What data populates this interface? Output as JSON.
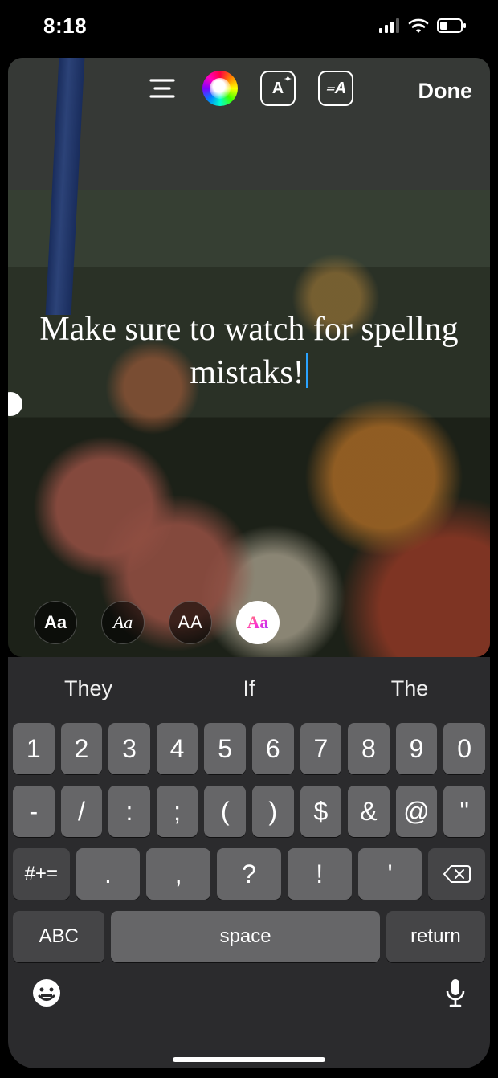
{
  "status": {
    "time": "8:18"
  },
  "toolbar": {
    "text_style_label": "A",
    "animate_label": "A",
    "done_label": "Done"
  },
  "story": {
    "text": "Make sure to watch for spellng mistaks!"
  },
  "font_picker": {
    "options": [
      "Aa",
      "Aa",
      "AA",
      "Aa"
    ],
    "selected_index": 3
  },
  "keyboard": {
    "suggestions": [
      "They",
      "If",
      "The"
    ],
    "row1": [
      "1",
      "2",
      "3",
      "4",
      "5",
      "6",
      "7",
      "8",
      "9",
      "0"
    ],
    "row2": [
      "-",
      "/",
      ":",
      ";",
      "(",
      ")",
      "$",
      "&",
      "@",
      "\""
    ],
    "row3_shift": "#+=",
    "row3": [
      ".",
      ",",
      "?",
      "!",
      "'"
    ],
    "abc": "ABC",
    "space": "space",
    "return": "return"
  }
}
